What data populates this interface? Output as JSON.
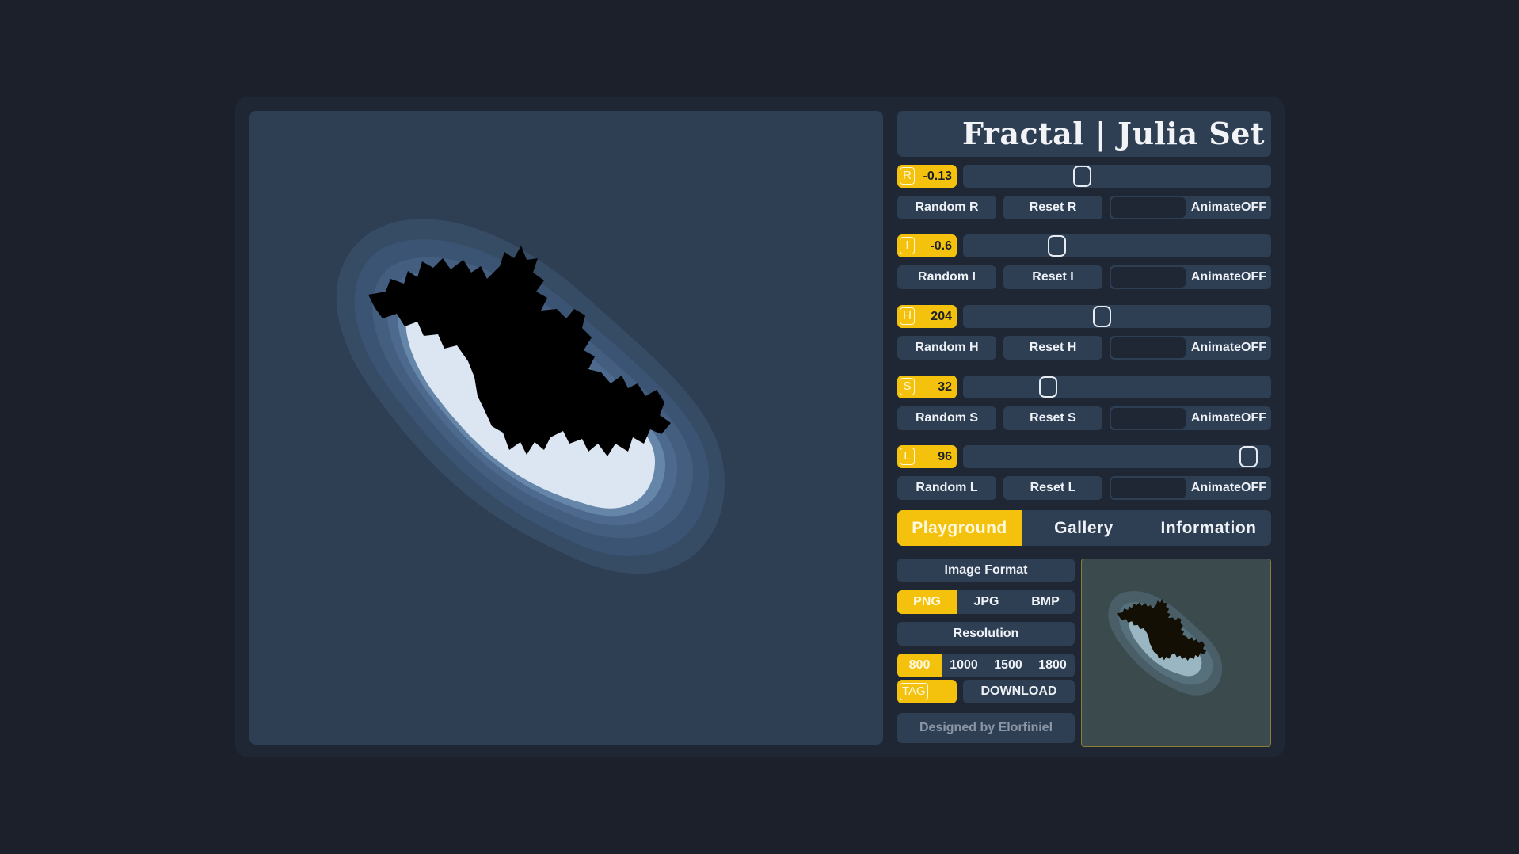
{
  "title": "Fractal | Julia Set",
  "params": [
    {
      "letter": "R",
      "value": "-0.13",
      "position": 0.38,
      "random_label": "Random R",
      "reset_label": "Reset R",
      "animate_label": "AnimateOFF"
    },
    {
      "letter": "I",
      "value": "-0.6",
      "position": 0.29,
      "random_label": "Random I",
      "reset_label": "Reset I",
      "animate_label": "AnimateOFF"
    },
    {
      "letter": "H",
      "value": "204",
      "position": 0.45,
      "random_label": "Random H",
      "reset_label": "Reset H",
      "animate_label": "AnimateOFF"
    },
    {
      "letter": "S",
      "value": "32",
      "position": 0.26,
      "random_label": "Random S",
      "reset_label": "Reset S",
      "animate_label": "AnimateOFF"
    },
    {
      "letter": "L",
      "value": "96",
      "position": 0.96,
      "random_label": "Random L",
      "reset_label": "Reset L",
      "animate_label": "AnimateOFF"
    }
  ],
  "tabs": [
    {
      "label": "Playground",
      "active": true
    },
    {
      "label": "Gallery",
      "active": false
    },
    {
      "label": "Information",
      "active": false
    }
  ],
  "image_format": {
    "label": "Image Format",
    "options": [
      "PNG",
      "JPG",
      "BMP"
    ],
    "selected": "PNG"
  },
  "resolution": {
    "label": "Resolution",
    "options": [
      "800",
      "1000",
      "1500",
      "1800"
    ],
    "selected": "800"
  },
  "tag_label": "TAG",
  "download_label": "DOWNLOAD",
  "credit": "Designed by Elorfiniel",
  "colors": {
    "page_bg": "#1b202b",
    "panel_bg": "#2e3e53",
    "accent": "#f4c20d",
    "fractal": "#000000",
    "glow": "#dbe6f2"
  },
  "icons": [
    "slider-thumb",
    "letter-badge"
  ]
}
